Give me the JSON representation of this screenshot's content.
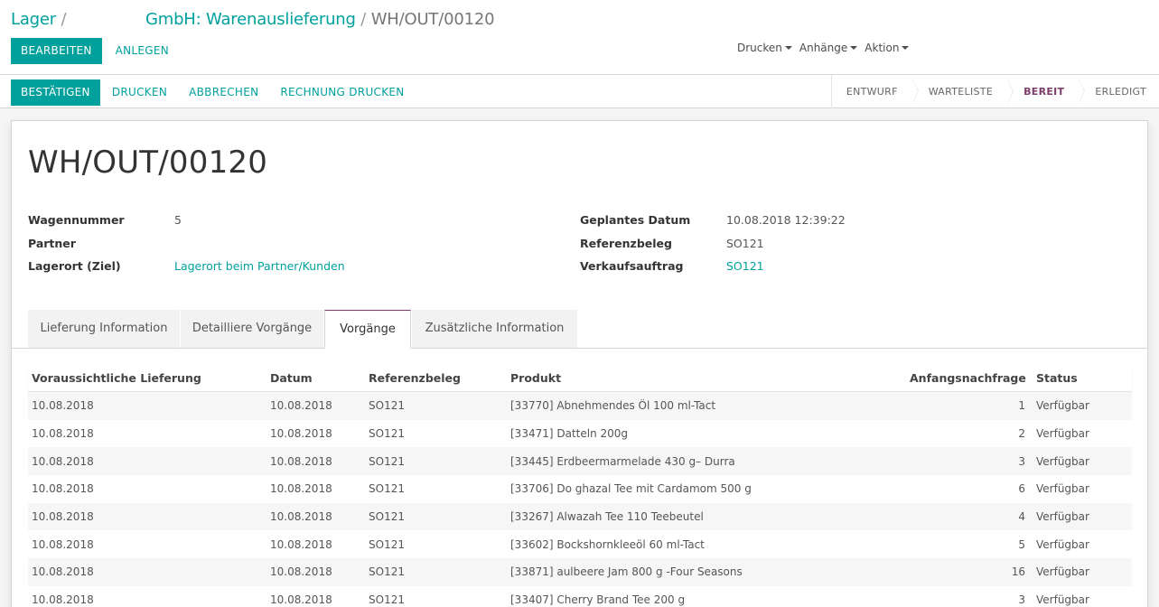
{
  "breadcrumb": {
    "part1": "Lager",
    "sep1": "/",
    "part2": "GmbH: Warenauslieferung",
    "sep2": "/",
    "current": "WH/OUT/00120"
  },
  "control": {
    "edit_label": "BEARBEITEN",
    "create_label": "ANLEGEN",
    "print_label": "Drucken",
    "attachments_label": "Anhänge",
    "action_label": "Aktion"
  },
  "statusbar": {
    "buttons": [
      "BESTÄTIGEN",
      "DRUCKEN",
      "ABBRECHEN",
      "RECHNUNG DRUCKEN"
    ],
    "stages": [
      "ENTWURF",
      "WARTELISTE",
      "BEREIT",
      "ERLEDIGT"
    ],
    "active_stage": "BEREIT"
  },
  "form": {
    "title": "WH/OUT/00120",
    "left": [
      {
        "label": "Wagennummer",
        "value": "5"
      },
      {
        "label": "Partner",
        "value": ""
      },
      {
        "label": "Lagerort (Ziel)",
        "value": "Lagerort beim Partner/Kunden"
      }
    ],
    "right": [
      {
        "label": "Geplantes Datum",
        "value": "10.08.2018 12:39:22"
      },
      {
        "label": "Referenzbeleg",
        "value": "SO121"
      },
      {
        "label": "Verkaufsauftrag",
        "value": "SO121"
      }
    ]
  },
  "tabs": [
    "Lieferung Information",
    "Detailliere Vorgänge",
    "Vorgänge",
    "Zusätzliche Information"
  ],
  "active_tab": "Vorgänge",
  "table": {
    "headers": [
      "Voraussichtliche Lieferung",
      "Datum",
      "Referenzbeleg",
      "Produkt",
      "Anfangsnachfrage",
      "Status"
    ],
    "rows": [
      [
        "10.08.2018",
        "10.08.2018",
        "SO121",
        "[33770] Abnehmendes Öl 100 ml-Tact",
        "1",
        "Verfügbar"
      ],
      [
        "10.08.2018",
        "10.08.2018",
        "SO121",
        "[33471] Datteln 200g",
        "2",
        "Verfügbar"
      ],
      [
        "10.08.2018",
        "10.08.2018",
        "SO121",
        "[33445] Erdbeermarmelade 430 g– Durra",
        "3",
        "Verfügbar"
      ],
      [
        "10.08.2018",
        "10.08.2018",
        "SO121",
        "[33706] Do ghazal Tee mit Cardamom 500 g",
        "6",
        "Verfügbar"
      ],
      [
        "10.08.2018",
        "10.08.2018",
        "SO121",
        "[33267] Alwazah Tee 110 Teebeutel",
        "4",
        "Verfügbar"
      ],
      [
        "10.08.2018",
        "10.08.2018",
        "SO121",
        "[33602] Bockshornkleeöl 60 ml-Tact",
        "5",
        "Verfügbar"
      ],
      [
        "10.08.2018",
        "10.08.2018",
        "SO121",
        "[33871] aulbeere Jam 800 g -Four Seasons",
        "16",
        "Verfügbar"
      ],
      [
        "10.08.2018",
        "10.08.2018",
        "SO121",
        "[33407] Cherry Brand Tee 200 g",
        "3",
        "Verfügbar"
      ]
    ]
  },
  "colors": {
    "primary": "#00a09d",
    "active_stage": "#7c3d6b"
  }
}
